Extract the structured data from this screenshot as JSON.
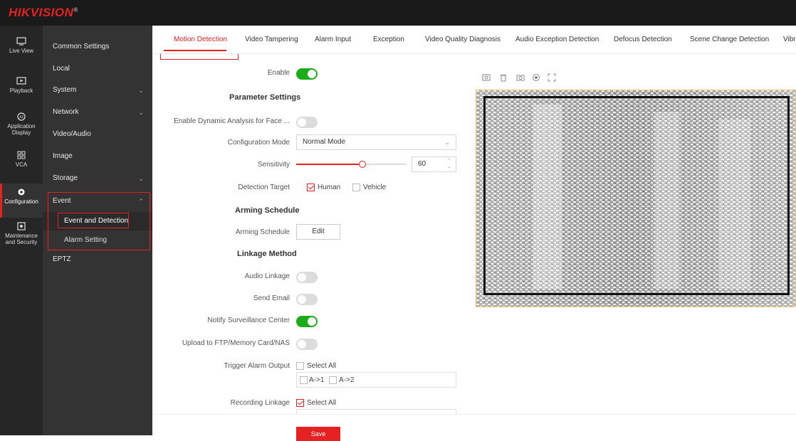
{
  "app": {
    "brand": "HIKVISION",
    "trademark": "®"
  },
  "left_nav": [
    {
      "label": "Live View",
      "icon": "monitor-icon"
    },
    {
      "label": "Playback",
      "icon": "playback-icon"
    },
    {
      "label": "Application Display",
      "icon": "application-icon"
    },
    {
      "label": "VCA",
      "icon": "vca-icon"
    },
    {
      "label": "Configuration",
      "icon": "gear-icon",
      "active": true
    },
    {
      "label": "Maintenance and Security",
      "icon": "maintenance-icon"
    }
  ],
  "menu": {
    "common_settings": "Common Settings",
    "local": "Local",
    "system": "System",
    "network": "Network",
    "video_audio": "Video/Audio",
    "image": "Image",
    "storage": "Storage",
    "event": "Event",
    "event_and_detection": "Event and Detection",
    "alarm_setting": "Alarm Setting",
    "eptz": "EPTZ"
  },
  "tabs": [
    "Motion Detection",
    "Video Tampering",
    "Alarm Input",
    "Exception",
    "Video Quality Diagnosis",
    "Audio Exception Detection",
    "Defocus Detection",
    "Scene Change Detection",
    "Vibra"
  ],
  "form": {
    "enable_label": "Enable",
    "enable_on": true,
    "parameter_settings": "Parameter Settings",
    "dynamic_face_label": "Enable Dynamic Analysis for Face ...",
    "dynamic_face_on": false,
    "config_mode_label": "Configuration Mode",
    "config_mode_value": "Normal Mode",
    "sensitivity_label": "Sensitivity",
    "sensitivity_value": "60",
    "sensitivity_fraction": 0.6,
    "detection_target_label": "Detection Target",
    "target_human": "Human",
    "target_human_checked": true,
    "target_vehicle": "Vehicle",
    "target_vehicle_checked": false,
    "arming_schedule_section": "Arming Schedule",
    "arming_schedule_label": "Arming Schedule",
    "edit_button": "Edit",
    "linkage_method": "Linkage Method",
    "audio_linkage_label": "Audio Linkage",
    "audio_linkage_on": false,
    "send_email_label": "Send Email",
    "send_email_on": false,
    "notify_center_label": "Notify Surveillance Center",
    "notify_center_on": true,
    "upload_ftp_label": "Upload to FTP/Memory Card/NAS",
    "upload_ftp_on": false,
    "trigger_alarm_label": "Trigger Alarm Output",
    "select_all": "Select All",
    "alarm_out_1": "A->1",
    "alarm_out_2": "A->2",
    "recording_linkage_label": "Recording Linkage",
    "recording_select_all": "Select All",
    "save_button": "Save"
  },
  "preview_tools": [
    "snapshot-icon",
    "delete-icon",
    "camera-icon",
    "record-icon",
    "fullscreen-icon"
  ],
  "colors": {
    "accent": "#e52121",
    "toggle_on": "#1aad19",
    "sidebar": "#333333",
    "topbar": "#1a1a1a"
  }
}
